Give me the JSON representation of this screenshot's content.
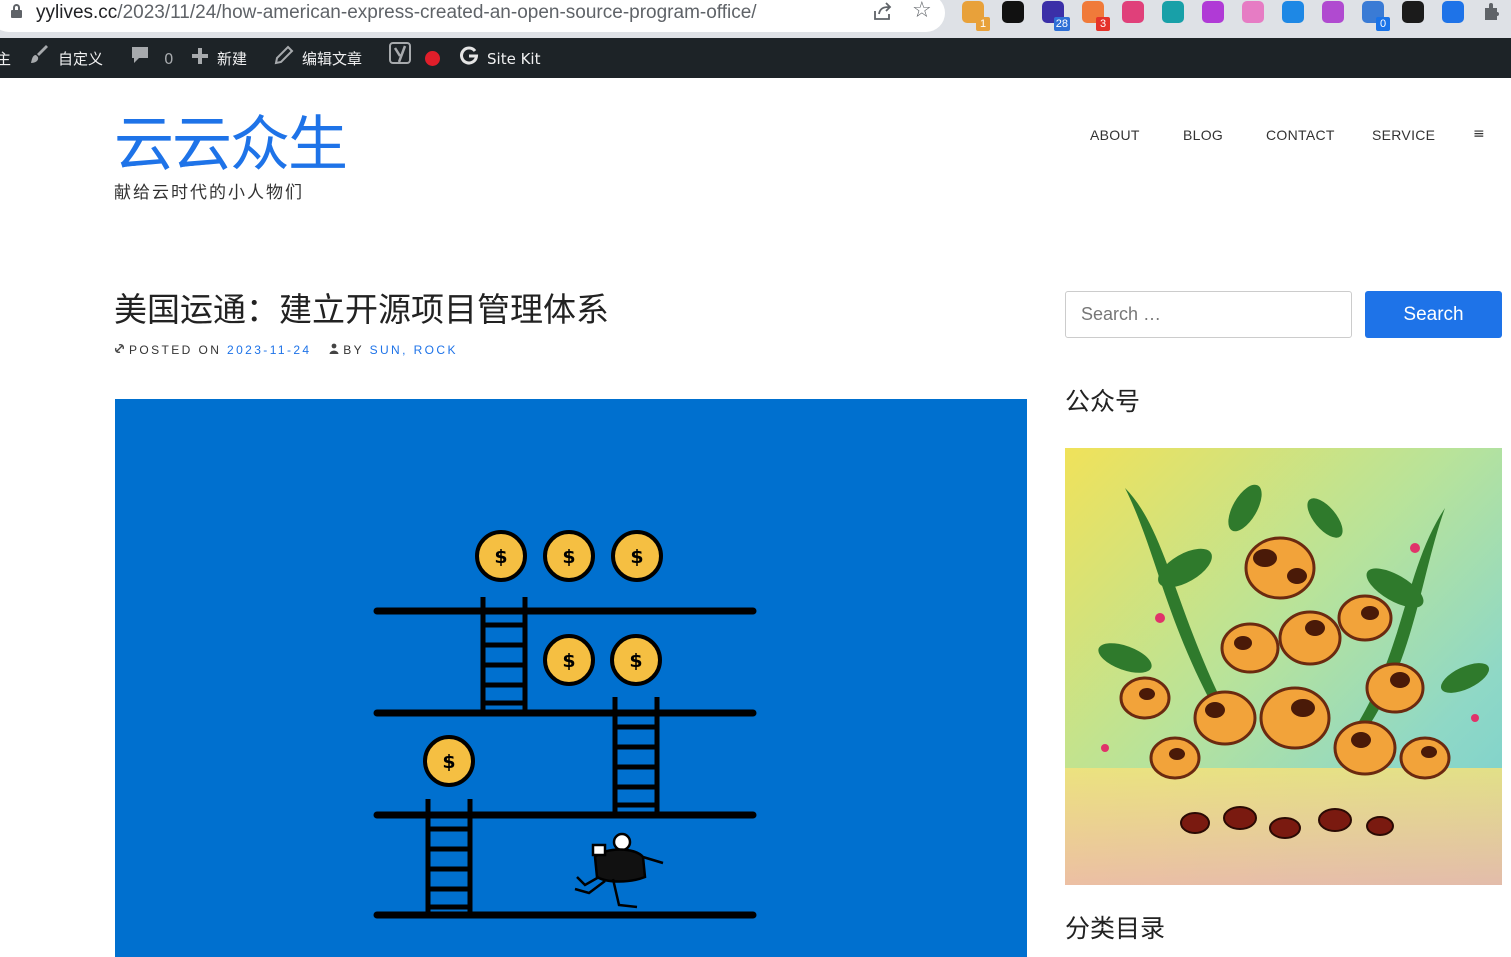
{
  "browser": {
    "url_host": "yylives.cc",
    "url_path": "/2023/11/24/how-american-express-created-an-open-source-program-office/",
    "extensions": [
      {
        "icon": "grammarly-extension-icon",
        "color": "#e8a13a",
        "badge": "1",
        "badge_color": "#e8a13a"
      },
      {
        "icon": "notion-extension-icon",
        "color": "#111111",
        "badge": "",
        "badge_color": ""
      },
      {
        "icon": "graduation-cap-extension-icon",
        "color": "#3b2fa8",
        "badge": "28",
        "badge_color": "#2f6fd6"
      },
      {
        "icon": "color-dots-extension-icon",
        "color": "#f07a3a",
        "badge": "3",
        "badge_color": "#e5332a"
      },
      {
        "icon": "translate-extension-icon",
        "color": "#e0407a",
        "badge": "",
        "badge_color": ""
      },
      {
        "icon": "grid-extension-icon",
        "color": "#18a0a8",
        "badge": "",
        "badge_color": ""
      },
      {
        "icon": "circle-logo-extension-icon",
        "color": "#b03ad6",
        "badge": "",
        "badge_color": ""
      },
      {
        "icon": "cloud-face-extension-icon",
        "color": "#e67cc4",
        "badge": "",
        "badge_color": ""
      },
      {
        "icon": "bookmark-extension-icon",
        "color": "#1e88e5",
        "badge": "",
        "badge_color": ""
      },
      {
        "icon": "openai-extension-icon",
        "color": "#b04ad0",
        "badge": "",
        "badge_color": ""
      },
      {
        "icon": "sync-extension-icon",
        "color": "#3a7bd5",
        "badge": "0",
        "badge_color": "#1a73e8"
      },
      {
        "icon": "dark-square-extension-icon",
        "color": "#1b1b1b",
        "badge": "",
        "badge_color": ""
      },
      {
        "icon": "blue-circle-extension-icon",
        "color": "#1e73e8",
        "badge": "",
        "badge_color": ""
      },
      {
        "icon": "puzzle-extensions-icon",
        "color": "#5f6368",
        "badge": "",
        "badge_color": ""
      }
    ]
  },
  "adminbar": {
    "partial_item": "主",
    "customize": "自定义",
    "comments_count": "0",
    "new": "新建",
    "edit_post": "编辑文章",
    "site_kit": "Site Kit"
  },
  "site": {
    "title": "云云众生",
    "description": "献给云时代的小人物们",
    "accent": "#1e73e8"
  },
  "nav": {
    "items": [
      "ABOUT",
      "BLOG",
      "CONTACT",
      "SERVICE"
    ],
    "menu_icon": "≡"
  },
  "post": {
    "title": "美国运通：建立开源项目管理体系",
    "posted_on_label": "POSTED ON",
    "date": "2023-11-24",
    "by_label": "BY",
    "author": "SUN, ROCK"
  },
  "sidebar": {
    "search_placeholder": "Search …",
    "search_button": "Search",
    "widget1_title": "公众号",
    "widget2_title": "分类目录"
  }
}
